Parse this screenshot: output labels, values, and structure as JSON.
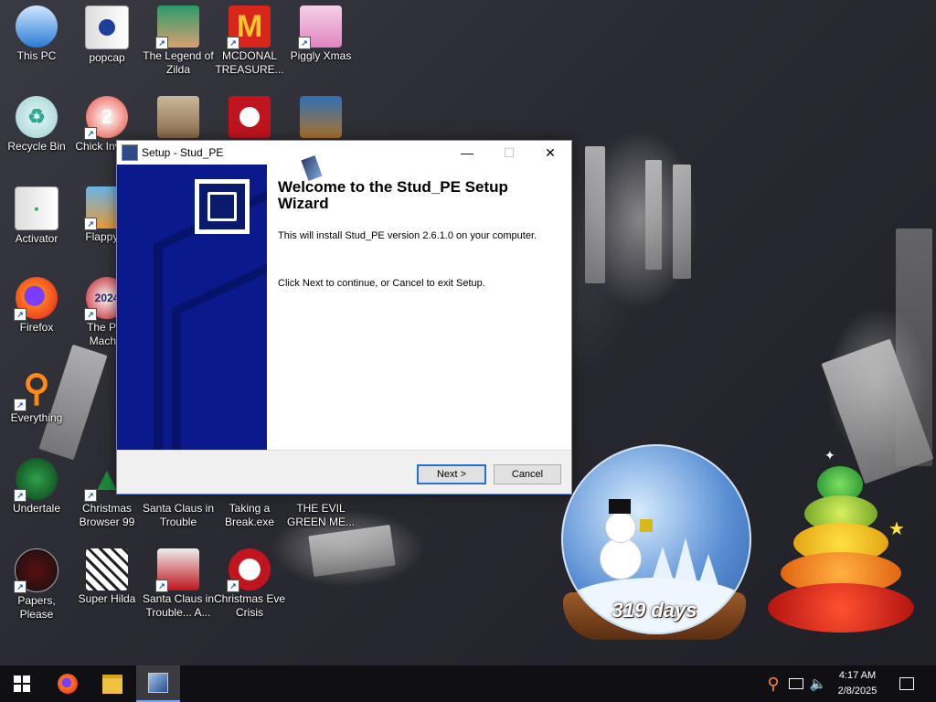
{
  "desktop": {
    "icons": [
      {
        "label": "This PC",
        "icon": "computer-icon"
      },
      {
        "label": "popcap",
        "icon": "folder-icon"
      },
      {
        "label": "The Legend of Zilda",
        "icon": "game-icon"
      },
      {
        "label": "MCDONAL TREASURE...",
        "icon": "mcdonalds-icon"
      },
      {
        "label": "Piggly Xmas",
        "icon": "pig-icon"
      },
      {
        "label": "Recycle Bin",
        "icon": "recycle-bin-icon"
      },
      {
        "label": "Chick Invade",
        "icon": "chicken-icon"
      },
      {
        "label": "Activator",
        "icon": "file-icon"
      },
      {
        "label": "Flappy P",
        "icon": "game-icon"
      },
      {
        "label": "Firefox",
        "icon": "firefox-icon"
      },
      {
        "label": "The Poli Machin",
        "icon": "game-icon"
      },
      {
        "label": "Everything",
        "icon": "search-icon"
      },
      {
        "label": "Undertale",
        "icon": "game-icon"
      },
      {
        "label": "Christmas Browser 99",
        "icon": "tree-icon"
      },
      {
        "label": "Santa Claus in Trouble",
        "icon": "game-icon"
      },
      {
        "label": "Taking a Break.exe",
        "icon": "game-icon"
      },
      {
        "label": "THE EVIL GREEN ME...",
        "icon": "game-icon"
      },
      {
        "label": "Papers, Please",
        "icon": "game-icon"
      },
      {
        "label": "Super Hilda",
        "icon": "game-icon"
      },
      {
        "label": "Santa Claus in Trouble... A...",
        "icon": "santa-icon"
      },
      {
        "label": "Christmas Eve Crisis",
        "icon": "santa-icon"
      }
    ]
  },
  "dialog": {
    "title": "Setup - Stud_PE",
    "minimize": "—",
    "maximize": "☐",
    "close": "✕",
    "heading": "Welcome to the Stud_PE Setup Wizard",
    "line1": "This will install Stud_PE version 2.6.1.0 on your computer.",
    "line2": "Click Next to continue, or Cancel to exit Setup.",
    "next_label": "Next >",
    "cancel_label": "Cancel"
  },
  "widgets": {
    "countdown": "319 days"
  },
  "taskbar": {
    "items": [
      "start-icon",
      "firefox-icon",
      "file-explorer-icon",
      "setup-icon"
    ],
    "tray": [
      "everything-search-icon",
      "network-icon",
      "volume-icon"
    ],
    "time": "4:17 AM",
    "date": "2/8/2025",
    "notification": "notification-icon"
  },
  "colors": {
    "wizard_panel": "#0a1a8c",
    "default_button_border": "#2a6fd4",
    "taskbar": "#101014"
  }
}
